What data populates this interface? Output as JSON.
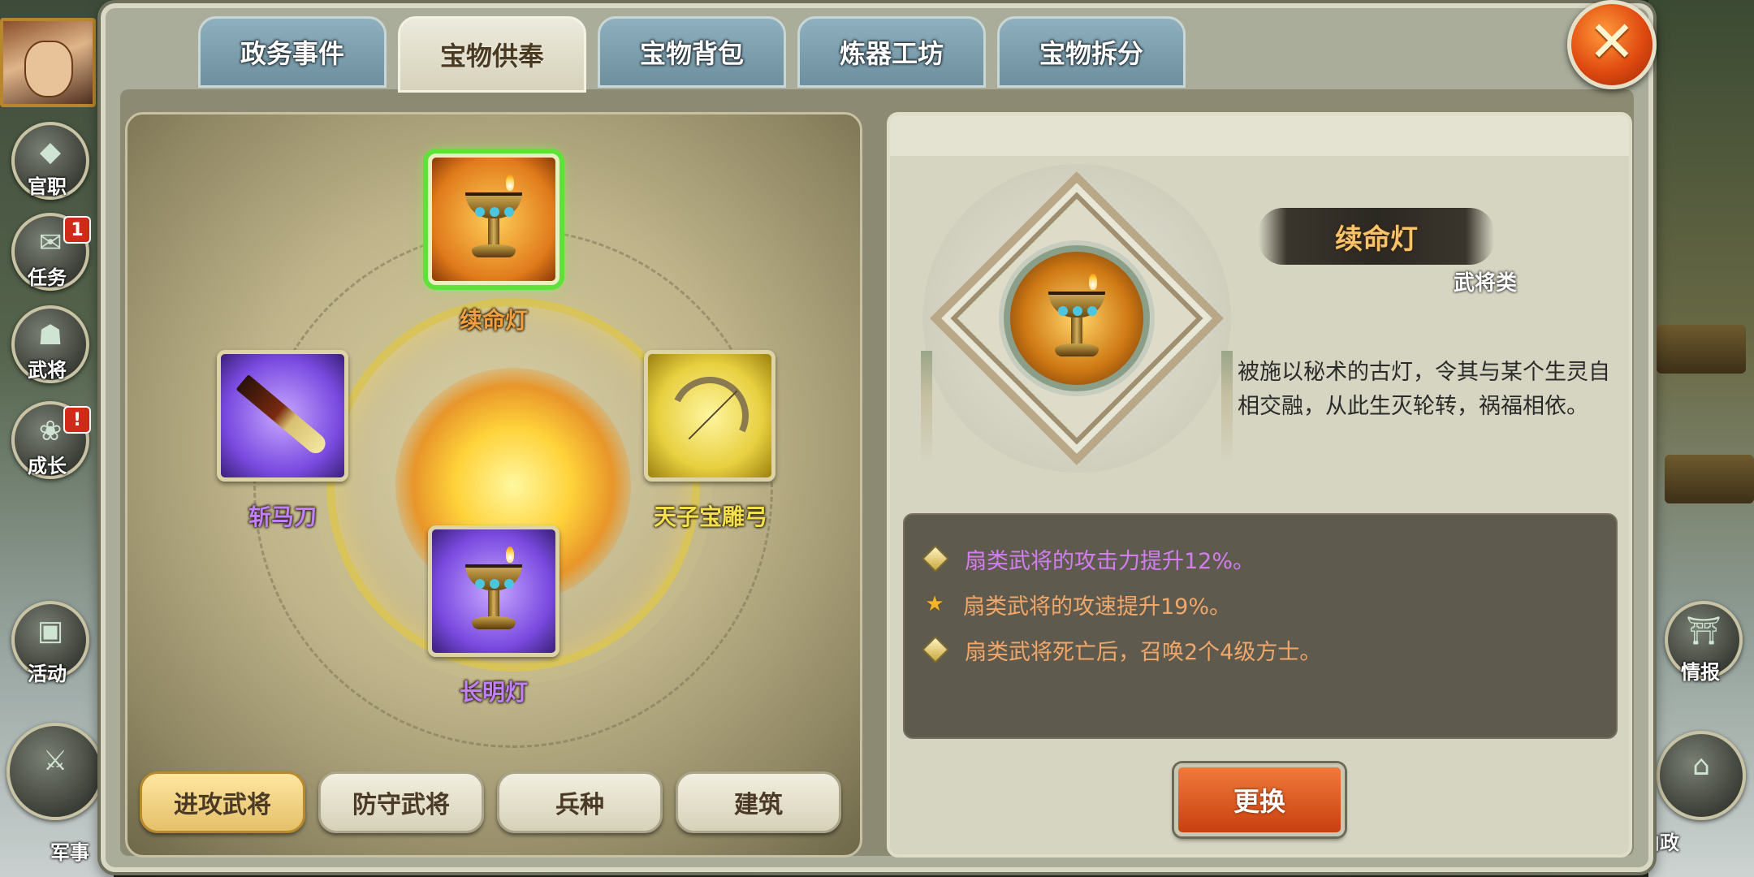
{
  "tabs": [
    {
      "label": "政务事件"
    },
    {
      "label": "宝物供奉"
    },
    {
      "label": "宝物背包"
    },
    {
      "label": "炼器工坊"
    },
    {
      "label": "宝物拆分"
    }
  ],
  "active_tab": "宝物供奉",
  "side_menu": {
    "left": [
      {
        "label": "官职",
        "badge": ""
      },
      {
        "label": "任务",
        "badge": "1"
      },
      {
        "label": "武将",
        "badge": ""
      },
      {
        "label": "成长",
        "badge": "!"
      },
      {
        "label": "活动",
        "badge": ""
      },
      {
        "label": "军事",
        "badge": ""
      }
    ],
    "right": [
      {
        "label": "情报"
      },
      {
        "label": "内政"
      }
    ]
  },
  "slots": {
    "top": {
      "name": "续命灯",
      "color": "#f0a040"
    },
    "left": {
      "name": "斩马刀",
      "color": "#c080ff"
    },
    "right": {
      "name": "天子宝雕弓",
      "color": "#f4e04a"
    },
    "bottom": {
      "name": "长明灯",
      "color": "#c080ff"
    }
  },
  "categories": [
    {
      "label": "进攻武将"
    },
    {
      "label": "防守武将"
    },
    {
      "label": "兵种"
    },
    {
      "label": "建筑"
    }
  ],
  "detail": {
    "name": "续命灯",
    "type": "武将类",
    "description": "被施以秘术的古灯，令其与某个生灵自相交融，从此生灭轮转，祸福相依。",
    "effects": [
      {
        "text": "扇类武将的攻击力提升12%。",
        "color": "#d27ef0",
        "icon": "diamond-icon"
      },
      {
        "text": "扇类武将的攻速提升19%。",
        "color": "#f0a86a",
        "icon": "star-icon"
      },
      {
        "text": "扇类武将死亡后，召唤2个4级方士。",
        "color": "#f0a86a",
        "icon": "diamond-icon"
      }
    ],
    "swap_label": "更换"
  }
}
